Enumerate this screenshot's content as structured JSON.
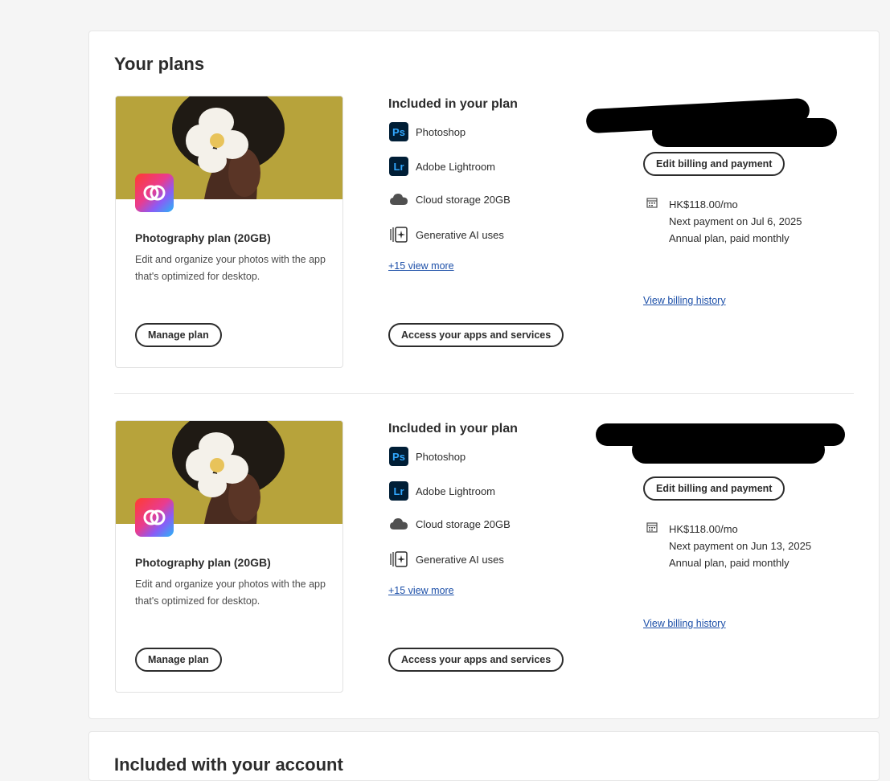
{
  "page_title": "Your plans",
  "section_two_title": "Included with your account",
  "plans": [
    {
      "name": "Photography plan (20GB)",
      "description": "Edit and organize your photos with the app that's optimized for desktop.",
      "manage_label": "Manage plan",
      "included_title": "Included in your plan",
      "items": [
        {
          "badge": "Ps",
          "label": "Photoshop",
          "icon": "photoshop-icon"
        },
        {
          "badge": "Lr",
          "label": "Adobe Lightroom",
          "icon": "lightroom-icon"
        },
        {
          "badge": "",
          "label": "Cloud storage 20GB",
          "icon": "cloud-icon"
        },
        {
          "badge": "",
          "label": "Generative AI uses",
          "icon": "generative-ai-icon"
        }
      ],
      "view_more": "+15 view more",
      "access_label": "Access your apps and services",
      "billing_label": "Edit billing and payment",
      "price": "HK$118.00/mo",
      "next_payment": "Next payment on Jul 6, 2025",
      "plan_type": "Annual plan, paid monthly",
      "history_label": "View billing history"
    },
    {
      "name": "Photography plan (20GB)",
      "description": "Edit and organize your photos with the app that's optimized for desktop.",
      "manage_label": "Manage plan",
      "included_title": "Included in your plan",
      "items": [
        {
          "badge": "Ps",
          "label": "Photoshop",
          "icon": "photoshop-icon"
        },
        {
          "badge": "Lr",
          "label": "Adobe Lightroom",
          "icon": "lightroom-icon"
        },
        {
          "badge": "",
          "label": "Cloud storage 20GB",
          "icon": "cloud-icon"
        },
        {
          "badge": "",
          "label": "Generative AI uses",
          "icon": "generative-ai-icon"
        }
      ],
      "view_more": "+15 view more",
      "access_label": "Access your apps and services",
      "billing_label": "Edit billing and payment",
      "price": "HK$118.00/mo",
      "next_payment": "Next payment on Jun 13, 2025",
      "plan_type": "Annual plan, paid monthly",
      "history_label": "View billing history"
    }
  ]
}
